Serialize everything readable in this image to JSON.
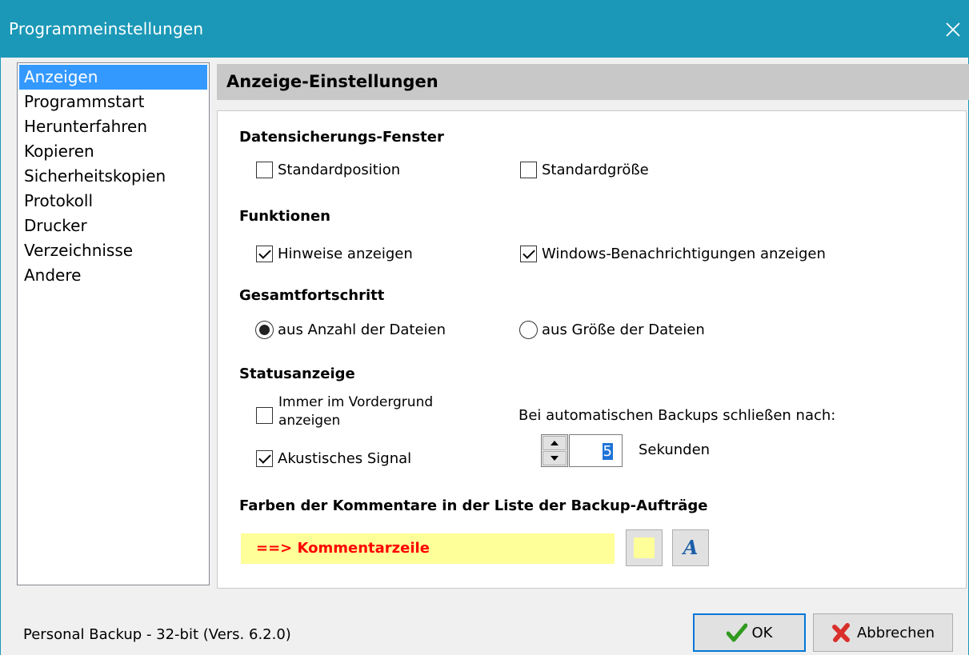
{
  "window": {
    "title": "Programmeinstellungen"
  },
  "nav": {
    "items": [
      {
        "label": "Anzeigen",
        "selected": true
      },
      {
        "label": "Programmstart",
        "selected": false
      },
      {
        "label": "Herunterfahren",
        "selected": false
      },
      {
        "label": "Kopieren",
        "selected": false
      },
      {
        "label": "Sicherheitskopien",
        "selected": false
      },
      {
        "label": "Protokoll",
        "selected": false
      },
      {
        "label": "Drucker",
        "selected": false
      },
      {
        "label": "Verzeichnisse",
        "selected": false
      },
      {
        "label": "Andere",
        "selected": false
      }
    ]
  },
  "panel": {
    "header": "Anzeige-Einstellungen",
    "backup_window": {
      "title": "Datensicherungs-Fenster",
      "standard_position": {
        "label": "Standardposition",
        "checked": false
      },
      "standard_size": {
        "label": "Standardgröße",
        "checked": false
      }
    },
    "functions": {
      "title": "Funktionen",
      "show_hints": {
        "label": "Hinweise anzeigen",
        "checked": true
      },
      "windows_notifications": {
        "label": "Windows-Benachrichtigungen anzeigen",
        "checked": true
      }
    },
    "total_progress": {
      "title": "Gesamtfortschritt",
      "by_count": {
        "label": "aus Anzahl der Dateien",
        "selected": true
      },
      "by_size": {
        "label": "aus Größe der Dateien",
        "selected": false
      }
    },
    "status_display": {
      "title": "Statusanzeige",
      "always_on_top": {
        "label_line1": "Immer im Vordergrund",
        "label_line2": "anzeigen",
        "checked": false
      },
      "acoustic_signal": {
        "label": "Akustisches Signal",
        "checked": true
      },
      "close_after_label": "Bei automatischen Backups schließen nach:",
      "close_after_value": "5",
      "close_after_unit": "Sekunden"
    },
    "comment_colors": {
      "title": "Farben der Kommentare in der Liste der Backup-Aufträge",
      "preview_text": "==> Kommentarzeile",
      "background_color": "#ffff99",
      "text_color": "#ff0000"
    }
  },
  "footer": {
    "status": "Personal Backup - 32-bit (Vers. 6.2.0)",
    "ok_label": "OK",
    "cancel_label": "Abbrechen"
  },
  "colors": {
    "titlebar": "#1b98b7",
    "selection": "#3399ff",
    "header_bg": "#c8c8c8"
  }
}
